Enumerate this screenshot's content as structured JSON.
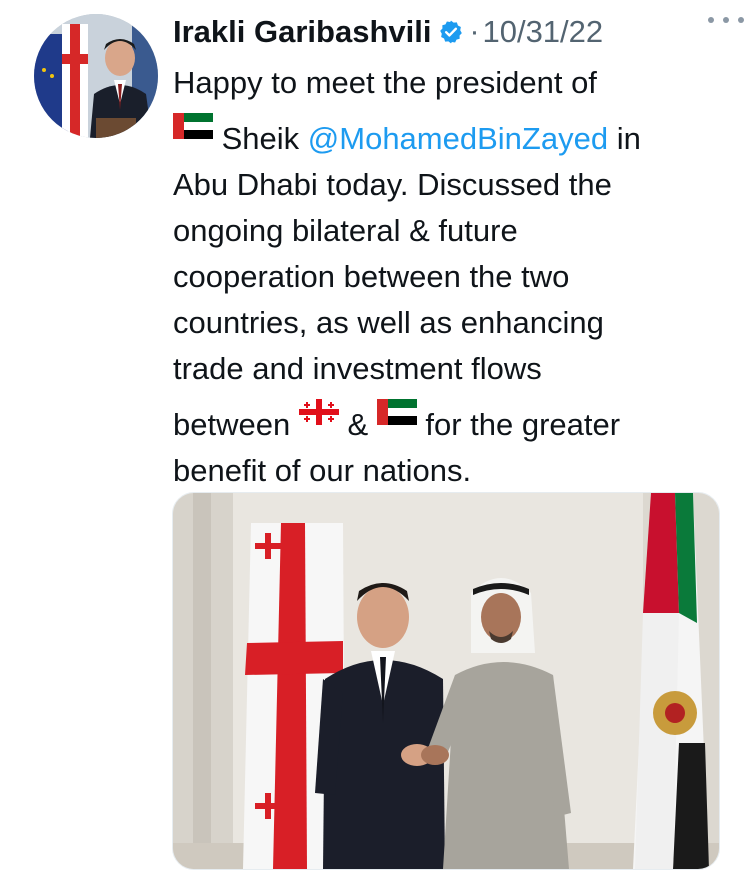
{
  "author": {
    "name": "Irakli Garibashvili",
    "verified_icon": "verified-badge-icon",
    "separator": "·",
    "date": "10/31/22",
    "avatar_icon": "avatar-photo"
  },
  "tweet": {
    "line1": "Happy to meet the president of",
    "line2_prefix": " Sheik ",
    "mention": "@MohamedBinZayed",
    "line2_suffix": " in",
    "line3": "Abu Dhabi today. Discussed the",
    "line4": "ongoing bilateral & future",
    "line5": "cooperation between the two",
    "line6": "countries, as well as enhancing",
    "line7": "trade and investment flows",
    "line8_prefix": "between ",
    "line8_mid": " & ",
    "line8_suffix": " for the greater",
    "line9": "benefit of our nations."
  },
  "colors": {
    "text": "#0f1419",
    "secondary": "#536471",
    "mention": "#1d9bf0",
    "verified": "#1d9bf0"
  },
  "media": {
    "icon": "photo-image"
  }
}
